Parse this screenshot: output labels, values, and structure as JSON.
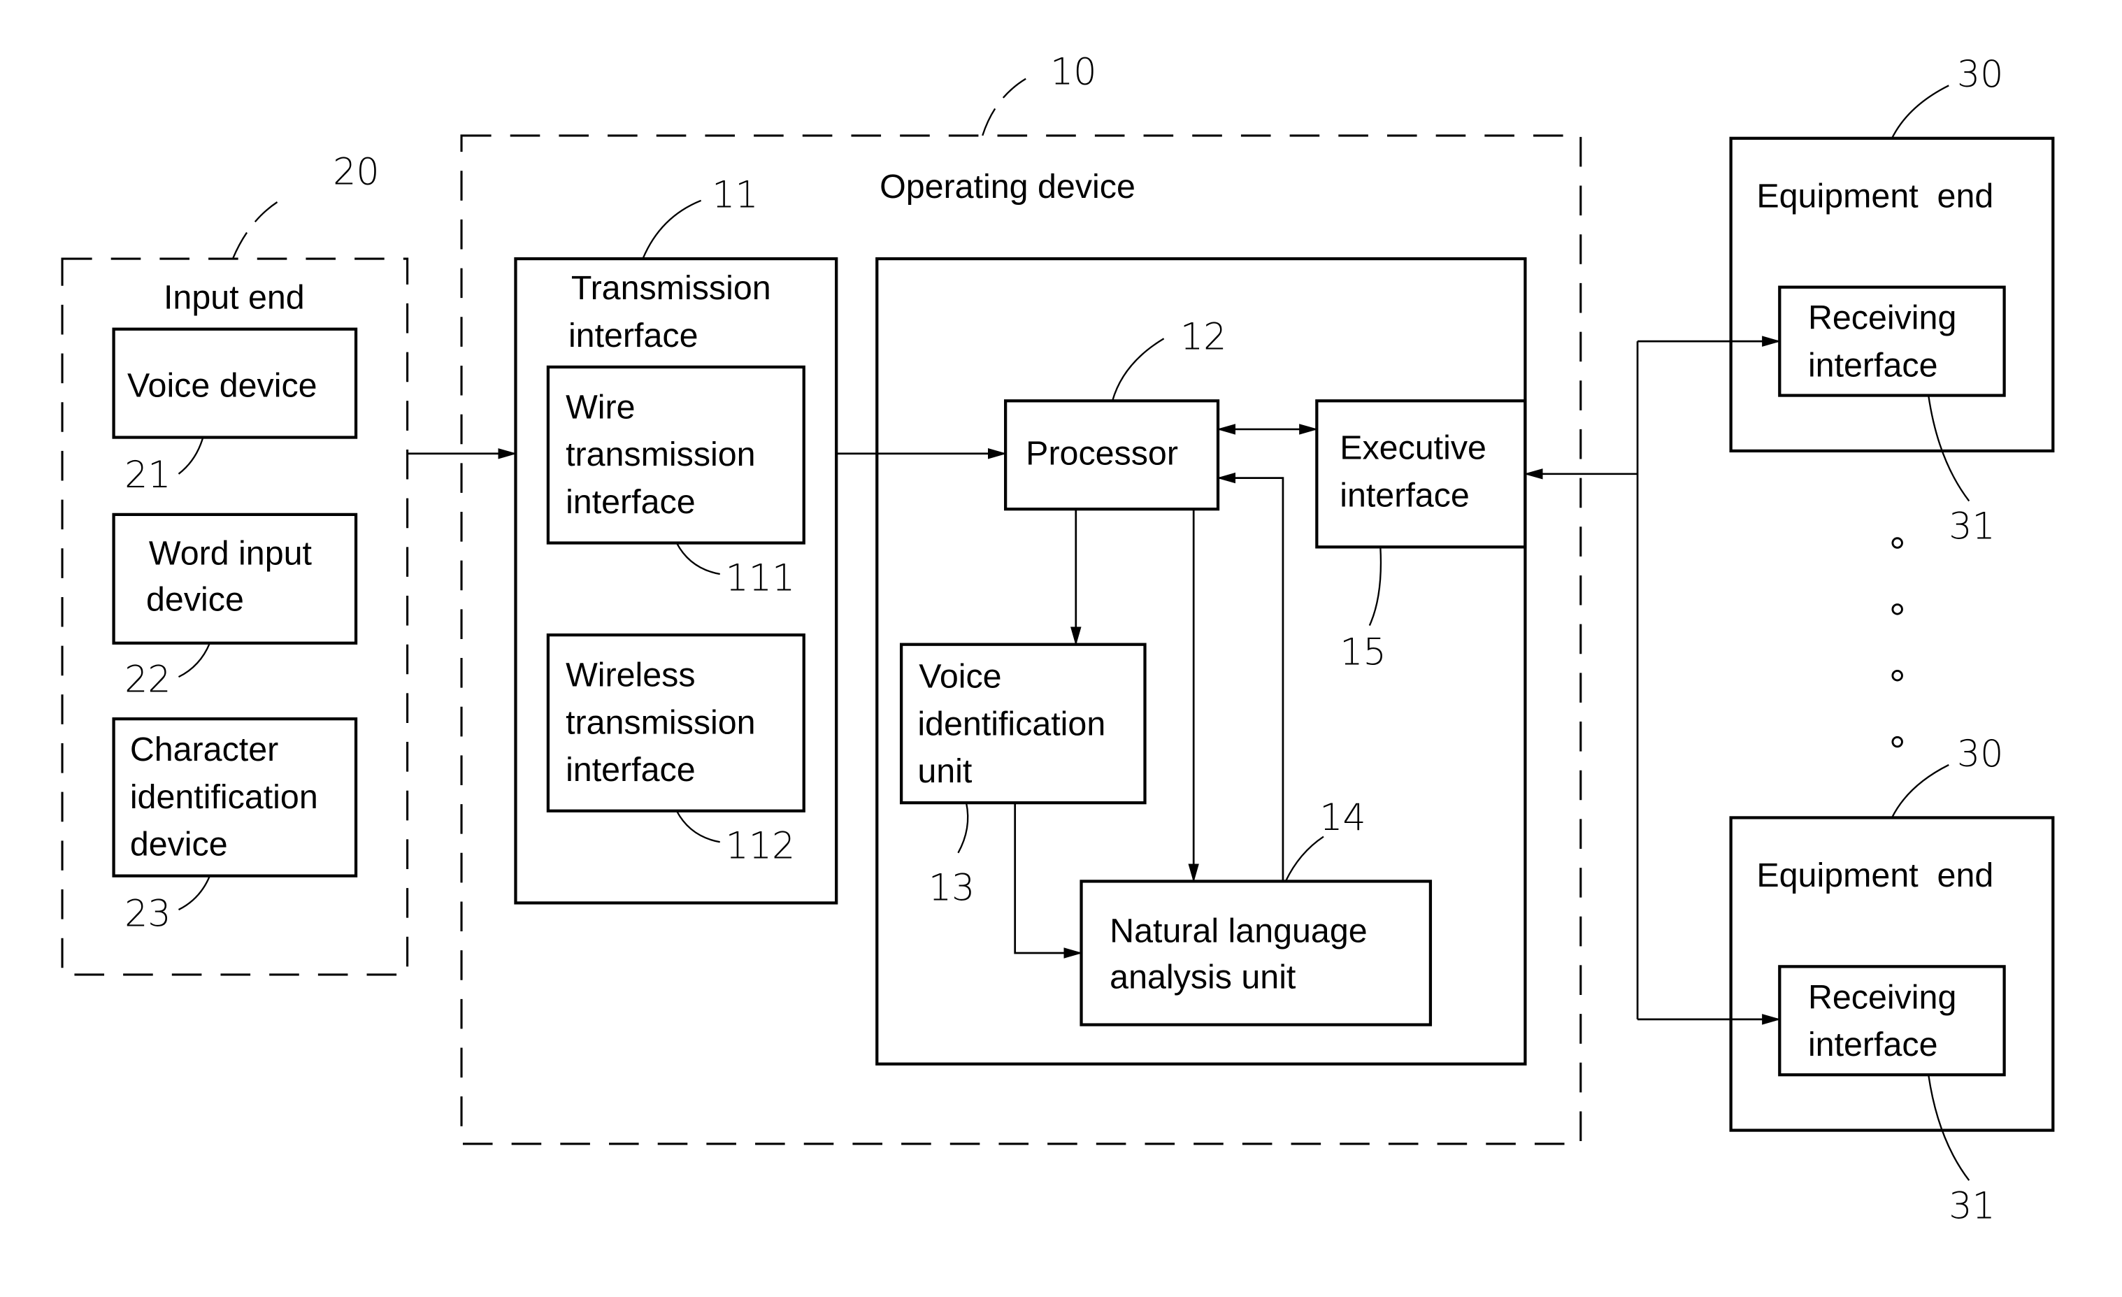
{
  "diagram": {
    "input_end": {
      "ref": "20",
      "title": "Input end",
      "devices": [
        {
          "ref": "21",
          "lines": [
            "Voice device"
          ]
        },
        {
          "ref": "22",
          "lines": [
            "Word input",
            "device"
          ]
        },
        {
          "ref": "23",
          "lines": [
            "Character",
            "identification",
            "device"
          ]
        }
      ]
    },
    "operating_device": {
      "ref": "10",
      "title": "Operating device",
      "transmission": {
        "ref": "11",
        "lines": [
          "Transmission",
          "interface"
        ],
        "wire": {
          "ref": "111",
          "lines": [
            "Wire",
            "transmission",
            "interface"
          ]
        },
        "wireless": {
          "ref": "112",
          "lines": [
            "Wireless",
            "transmission",
            "interface"
          ]
        }
      },
      "processor": {
        "ref": "12",
        "label": "Processor"
      },
      "voice_id": {
        "ref": "13",
        "lines": [
          "Voice",
          "identification",
          "unit"
        ]
      },
      "nla": {
        "ref": "14",
        "lines": [
          "Natural language",
          "analysis unit"
        ]
      },
      "executive": {
        "ref": "15",
        "lines": [
          "Executive",
          "interface"
        ]
      }
    },
    "equipment": [
      {
        "ref": "30",
        "title": "Equipment  end",
        "receiver_ref": "31",
        "receiver_lines": [
          "Receiving",
          "interface"
        ]
      },
      {
        "ref": "30",
        "title": "Equipment  end",
        "receiver_ref": "31",
        "receiver_lines": [
          "Receiving",
          "interface"
        ]
      }
    ]
  }
}
